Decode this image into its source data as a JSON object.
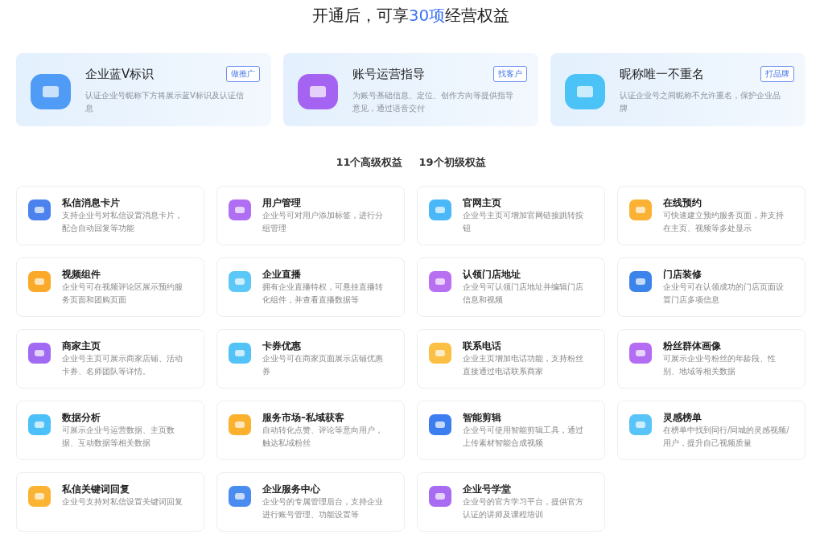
{
  "heading": {
    "before": "开通后，可享",
    "highlight": "30项",
    "after": "经营权益"
  },
  "featured": [
    {
      "title": "企业蓝V标识",
      "tag": "做推广",
      "desc": "认证企业号昵称下方将展示蓝V标识及认证信息",
      "color": "#4f9bf5"
    },
    {
      "title": "账号运营指导",
      "tag": "找客户",
      "desc": "为账号基础信息、定位、创作方向等提供指导意见，通过语音交付",
      "color": "#a463f0"
    },
    {
      "title": "昵称唯一不重名",
      "tag": "打品牌",
      "desc": "认证企业号之间昵称不允许重名，保护企业品牌",
      "color": "#4cc3f7"
    }
  ],
  "tabs": [
    "11个高级权益",
    "19个初级权益"
  ],
  "benefits": [
    {
      "title": "私信消息卡片",
      "desc": "支持企业号对私信设置消息卡片，配合自动回复等功能",
      "color": "#4b82ee"
    },
    {
      "title": "用户管理",
      "desc": "企业号可对用户添加标签，进行分组管理",
      "color": "#b06ef3"
    },
    {
      "title": "官网主页",
      "desc": "企业号主页可增加官网链接跳转按钮",
      "color": "#4ab8f8"
    },
    {
      "title": "在线预约",
      "desc": "可快速建立预约服务页面，并支持在主页、视频等多处显示",
      "color": "#fbb234"
    },
    {
      "title": "视频组件",
      "desc": "企业号可在视频评论区展示预约服务页面和团购页面",
      "color": "#fba928"
    },
    {
      "title": "企业直播",
      "desc": "拥有企业直播特权，可悬挂直播转化组件，并查看直播数据等",
      "color": "#5cc8f8"
    },
    {
      "title": "认领门店地址",
      "desc": "企业号可认领门店地址并编辑门店信息和视频",
      "color": "#b870f0"
    },
    {
      "title": "门店装修",
      "desc": "企业号可在认领成功的门店页面设置门店多项信息",
      "color": "#3d84ea"
    },
    {
      "title": "商家主页",
      "desc": "企业号主页可展示商家店铺、活动卡券、名师团队等详情。",
      "color": "#a16af2"
    },
    {
      "title": "卡券优惠",
      "desc": "企业号可在商家页面展示店铺优惠券",
      "color": "#52c2f7"
    },
    {
      "title": "联系电话",
      "desc": "企业主页增加电话功能，支持粉丝直接通过电话联系商家",
      "color": "#fbc043"
    },
    {
      "title": "粉丝群体画像",
      "desc": "可展示企业号粉丝的年龄段、性别、地域等相关数据",
      "color": "#b36cf2"
    },
    {
      "title": "数据分析",
      "desc": "可展示企业号运营数据、主页数据、互动数据等相关数据",
      "color": "#4cc0f8"
    },
    {
      "title": "服务市场–私域获客",
      "desc": "自动转化点赞、评论等意向用户，触达私域粉丝",
      "color": "#fbb02e"
    },
    {
      "title": "智能剪辑",
      "desc": "企业号可使用智能剪辑工具，通过上传素材智能合成视频",
      "color": "#3c7df0"
    },
    {
      "title": "灵感榜单",
      "desc": "在榜单中找到同行/同城的灵感视频/用户，提升自己视频质量",
      "color": "#58c4f8"
    },
    {
      "title": "私信关键词回复",
      "desc": "企业号支持对私信设置关键词回复",
      "color": "#fbb334"
    },
    {
      "title": "企业服务中心",
      "desc": "企业号的专属管理后台，支持企业进行账号管理、功能设置等",
      "color": "#4a8cf0"
    },
    {
      "title": "企业号学堂",
      "desc": "企业号的官方学习平台，提供官方认证的讲师及课程培训",
      "color": "#a86cf2"
    }
  ]
}
